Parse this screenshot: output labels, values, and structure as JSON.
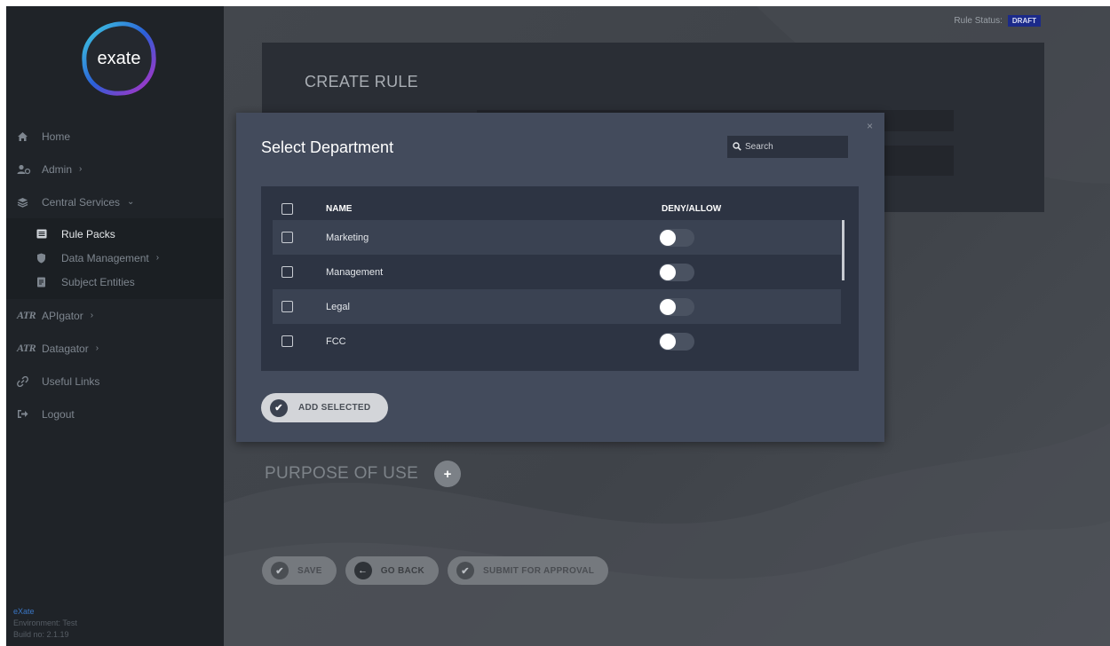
{
  "sidebar": {
    "logo_text": "exate",
    "nav": {
      "home": "Home",
      "admin": "Admin",
      "central_services": "Central Services",
      "rule_packs": "Rule Packs",
      "data_management": "Data Management",
      "subject_entities": "Subject Entities",
      "apigator": "APIgator",
      "datagator": "Datagator",
      "useful_links": "Useful Links",
      "logout": "Logout"
    },
    "brand_mark": "ATR",
    "footer": {
      "brand": "eXate",
      "environment": "Environment: Test",
      "build": "Build no: 2.1.19"
    }
  },
  "main": {
    "rule_status_label": "Rule Status:",
    "rule_status_badge": "DRAFT",
    "create_title": "CREATE RULE",
    "purpose_title": "PURPOSE OF USE",
    "buttons": {
      "save": "SAVE",
      "go_back": "GO BACK",
      "submit": "SUBMIT FOR APPROVAL"
    }
  },
  "modal": {
    "title": "Select Department",
    "close": "×",
    "search_placeholder": "Search",
    "columns": {
      "name": "NAME",
      "allow": "DENY/ALLOW"
    },
    "rows": [
      {
        "name": "Marketing",
        "allow": false
      },
      {
        "name": "Management",
        "allow": false
      },
      {
        "name": "Legal",
        "allow": false
      },
      {
        "name": "FCC",
        "allow": false
      }
    ],
    "add_button": "ADD SELECTED"
  },
  "colors": {
    "sidebar_bg": "#1f2328",
    "main_bg": "#43474d",
    "modal_bg": "#434b5c",
    "table_bg": "#2d3443",
    "badge_bg": "#1b2a8a",
    "footer_brand": "#3a76c4"
  },
  "icons": {
    "home": "home-icon",
    "admin": "users-icon",
    "central_services": "layers-icon",
    "rule_packs": "list-icon",
    "data_management": "shield-icon",
    "subject_entities": "document-icon",
    "useful_links": "link-icon",
    "logout": "logout-icon",
    "search": "search-icon",
    "check": "check-circle-icon",
    "back": "arrow-left-circle-icon",
    "plus": "plus-icon"
  }
}
